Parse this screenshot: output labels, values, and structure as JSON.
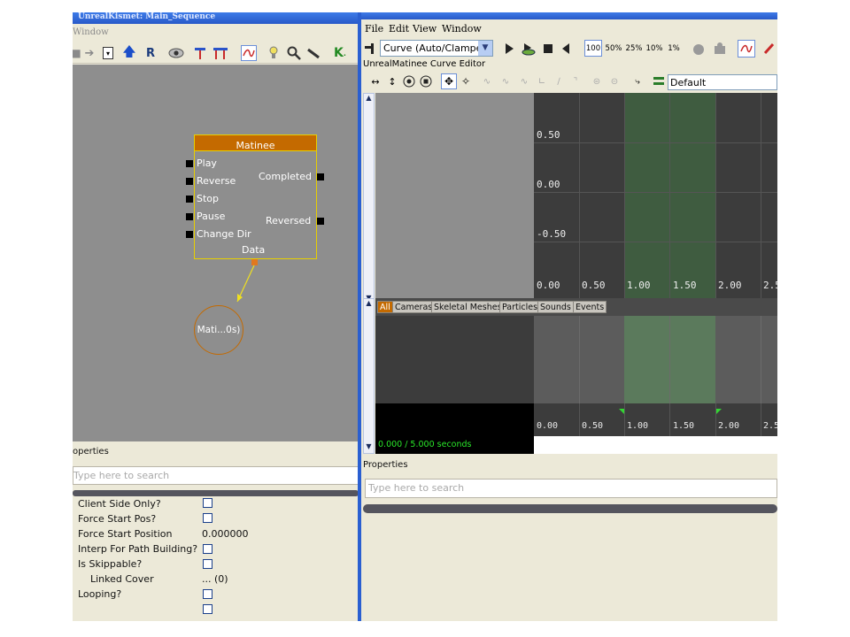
{
  "kismet": {
    "title": "UnrealKismet: Main_Sequence",
    "menu_window": "Window",
    "node": {
      "title": "Matinee",
      "inputs": [
        "Play",
        "Reverse",
        "Stop",
        "Pause",
        "Change Dir"
      ],
      "outputs": [
        "Completed",
        "Reversed"
      ],
      "data_label": "Data",
      "var_label": "Mati...0s)"
    },
    "properties": {
      "header": "operties",
      "search_placeholder": "Type here to search",
      "rows": [
        {
          "label": "Client Side Only?",
          "value": ""
        },
        {
          "label": "Force Start Pos?",
          "value": ""
        },
        {
          "label": "Force Start Position",
          "value": "0.000000"
        },
        {
          "label": "Interp For Path Building?",
          "value": ""
        },
        {
          "label": "Is Skippable?",
          "value": ""
        },
        {
          "label": "Linked Cover",
          "value": "... (0)"
        },
        {
          "label": "Looping?",
          "value": ""
        }
      ]
    }
  },
  "matinee": {
    "menu": [
      "File",
      "Edit",
      "View",
      "Window"
    ],
    "curve_mode": "Curve (Auto/Clampec",
    "speeds": [
      "100",
      "50%",
      "25%",
      "10%",
      "1%"
    ],
    "curve_editor_title": "UnrealMatinee Curve Editor",
    "preset": "Default",
    "curve_y_ticks": [
      "0.50",
      "0.00",
      "-0.50",
      "0.00"
    ],
    "curve_x_ticks": [
      "0.50",
      "1.00",
      "1.50",
      "2.00",
      "2.5"
    ],
    "tabs": [
      "All",
      "Cameras",
      "Skeletal Meshes",
      "Particles",
      "Sounds",
      "Events"
    ],
    "timeline_ticks": [
      "0.00",
      "0.50",
      "1.00",
      "1.50",
      "2.00",
      "2.50"
    ],
    "time_readout": "0.000 / 5.000 seconds",
    "properties_header": "Properties",
    "search_placeholder": "Type here to search"
  },
  "colors": {
    "node_header": "#c46a00",
    "node_border": "#e8d000",
    "grid_bg": "#3c3c3c",
    "loop_region": "#3f5c40",
    "time_text": "#29e629",
    "window_blue": "#2a5fd1"
  }
}
